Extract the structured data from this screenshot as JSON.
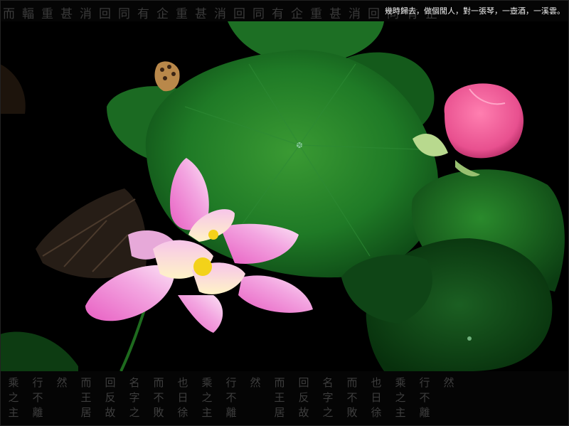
{
  "caption": "幾時歸去，做個閒人，對一張琴，一壺酒，一溪雲。",
  "top_decoration": "而輻重甚消回同有企重甚消回同有企重甚消回同有企",
  "bottom_columns": [
    "乘之主",
    "行不離",
    "然",
    "而王居",
    "回反故",
    "名字之",
    "而不敗",
    "也日徐",
    "乘之主",
    "行不離",
    "然",
    "而王居",
    "回反故",
    "名字之",
    "而不敗",
    "也日徐",
    "乘之主",
    "行不離",
    "然"
  ],
  "colors": {
    "background": "#000000",
    "lotus_pink": "#f3a6e1",
    "bud_pink": "#e8508f",
    "leaf_green": "#1f7a26",
    "stamen_yellow": "#f3d21a"
  }
}
